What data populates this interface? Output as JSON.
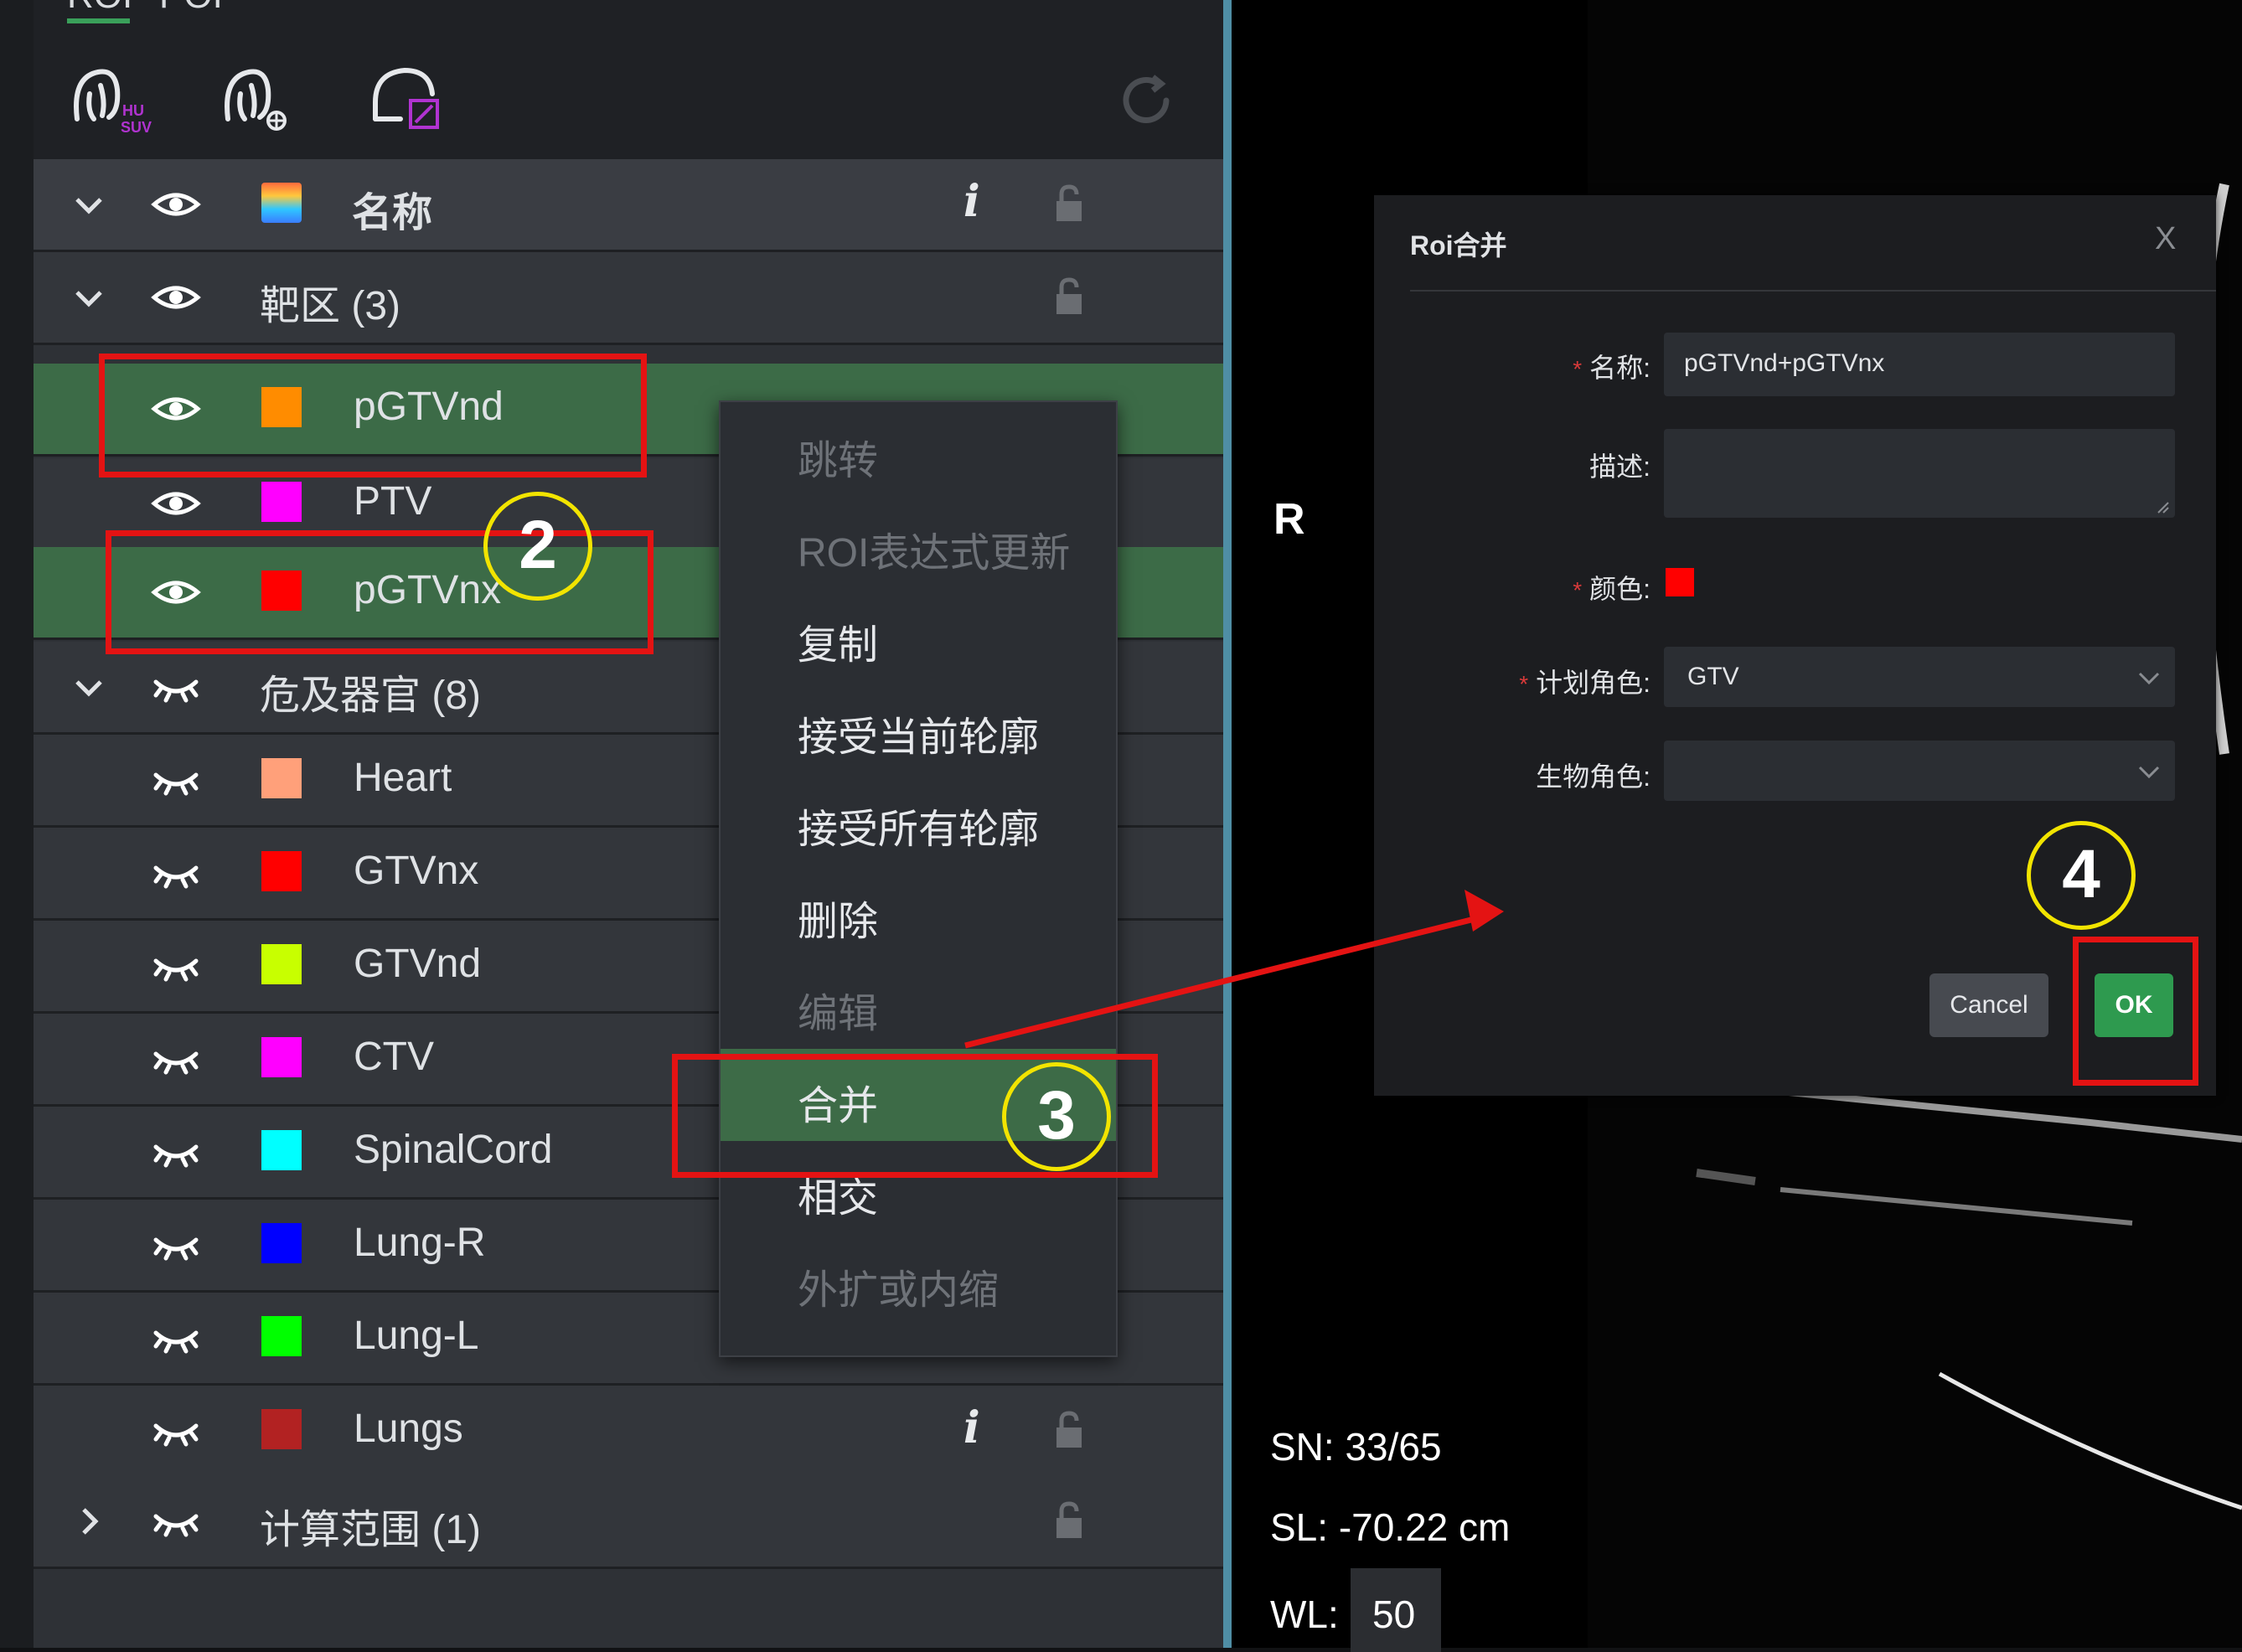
{
  "tabs": [
    "ROI",
    "POI"
  ],
  "toolbar": {
    "tool1_icon": "organ-hu-suv-icon",
    "tool1_badge_top": "HU",
    "tool1_badge_bottom": "SUV",
    "tool2_icon": "organ-ai-icon",
    "tool3_icon": "contour-edit-icon",
    "refresh_icon": "refresh-icon"
  },
  "roi_list": {
    "header": {
      "name": "名称",
      "info": "i"
    },
    "groups": [
      {
        "label": "靶区 (3)"
      },
      {
        "label": "危及器官 (8)"
      },
      {
        "label": "计算范围 (1)"
      }
    ],
    "targets": [
      {
        "name": "pGTVnd",
        "color": "#ff8c00"
      },
      {
        "name": "PTV",
        "color": "#ff00ff"
      },
      {
        "name": "pGTVnx",
        "color": "#ff0000"
      }
    ],
    "oars": [
      {
        "name": "Heart",
        "color": "#ffa07a"
      },
      {
        "name": "GTVnx",
        "color": "#ff0000"
      },
      {
        "name": "GTVnd",
        "color": "#c8ff00"
      },
      {
        "name": "CTV",
        "color": "#ff00ff"
      },
      {
        "name": "SpinalCord",
        "color": "#00ffff"
      },
      {
        "name": "Lung-R",
        "color": "#0000ff"
      },
      {
        "name": "Lung-L",
        "color": "#00ff00"
      },
      {
        "name": "Lungs",
        "color": "#b22222"
      }
    ]
  },
  "context_menu": {
    "items": [
      {
        "label": "跳转",
        "enabled": false
      },
      {
        "label": "ROI表达式更新",
        "enabled": false
      },
      {
        "label": "复制",
        "enabled": true
      },
      {
        "label": "接受当前轮廓",
        "enabled": true
      },
      {
        "label": "接受所有轮廓",
        "enabled": true
      },
      {
        "label": "删除",
        "enabled": true
      },
      {
        "label": "编辑",
        "enabled": false
      },
      {
        "label": "合并",
        "enabled": true,
        "active": true
      },
      {
        "label": "相交",
        "enabled": true
      },
      {
        "label": "外扩或内缩",
        "enabled": false
      }
    ]
  },
  "viewer": {
    "orientation": "R",
    "sn": "SN: 33/65",
    "sl": "SL: -70.22 cm",
    "wl_label": "WL:",
    "wl_value": "50"
  },
  "dialog": {
    "title": "Roi合并",
    "close": "X",
    "name_label": "名称:",
    "name_value": "pGTVnd+pGTVnx",
    "desc_label": "描述:",
    "color_label": "颜色:",
    "color_value": "#ff0000",
    "plan_role_label": "计划角色:",
    "plan_role_value": "GTV",
    "bio_role_label": "生物角色:",
    "bio_role_value": "",
    "required_mark": "*",
    "cancel": "Cancel",
    "ok": "OK"
  },
  "annotations": {
    "step2": "2",
    "step3": "3",
    "step4": "4",
    "highlight_color": "#e41313",
    "circle_color": "#f2e400"
  }
}
